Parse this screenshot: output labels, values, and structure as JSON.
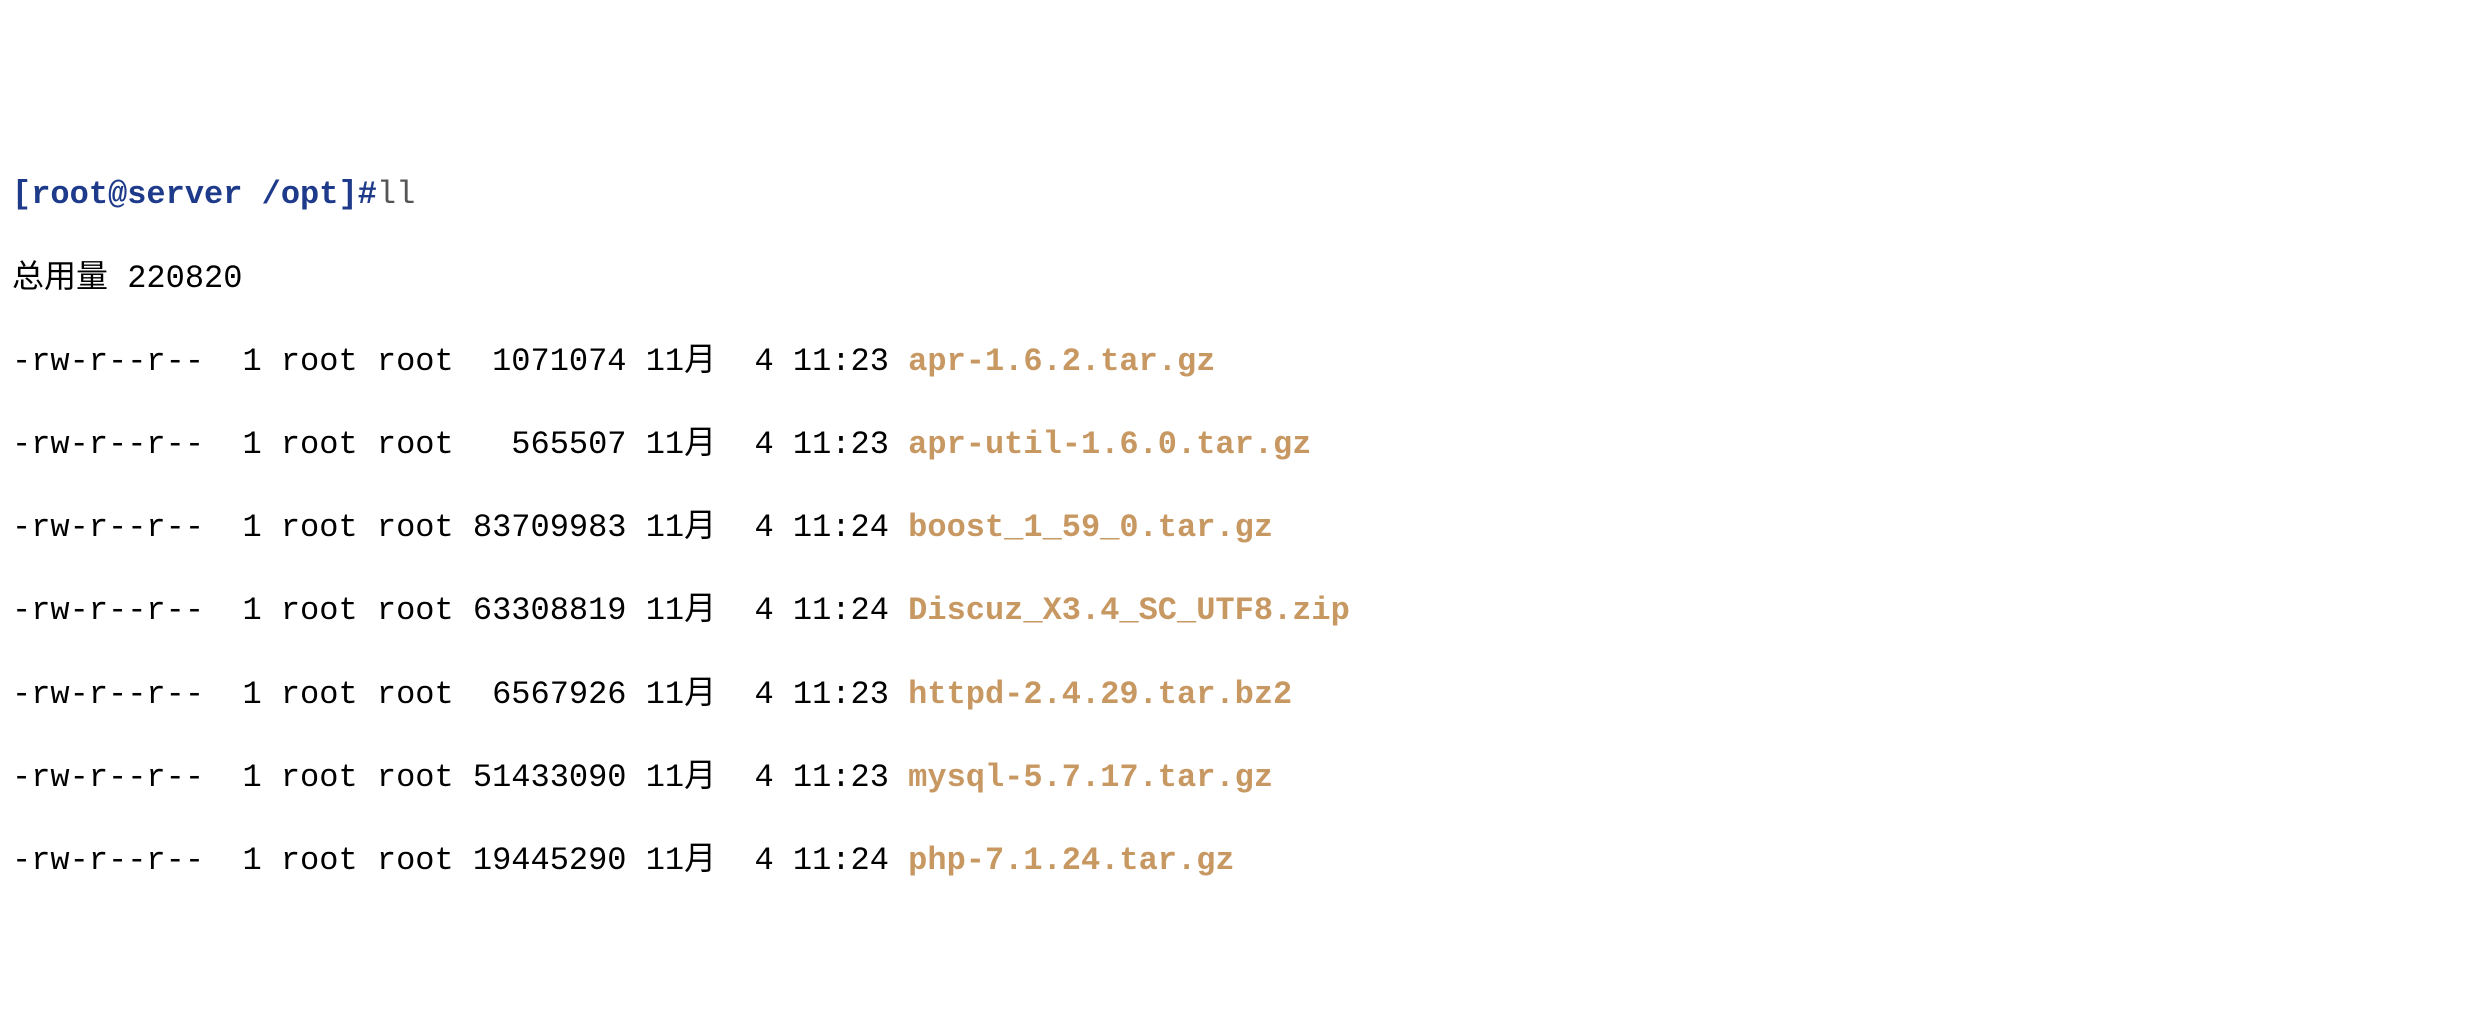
{
  "prompt": {
    "user_host": "[root@server",
    "path": " /opt]",
    "hash": "#",
    "command": "ll"
  },
  "total": {
    "label": "总用量 220820"
  },
  "files": [
    {
      "details": "-rw-r--r--  1 root root  1071074 11月  4 11:23 ",
      "name": "apr-1.6.2.tar.gz"
    },
    {
      "details": "-rw-r--r--  1 root root   565507 11月  4 11:23 ",
      "name": "apr-util-1.6.0.tar.gz"
    },
    {
      "details": "-rw-r--r--  1 root root 83709983 11月  4 11:24 ",
      "name": "boost_1_59_0.tar.gz"
    },
    {
      "details": "-rw-r--r--  1 root root 63308819 11月  4 11:24 ",
      "name": "Discuz_X3.4_SC_UTF8.zip"
    },
    {
      "details": "-rw-r--r--  1 root root  6567926 11月  4 11:23 ",
      "name": "httpd-2.4.29.tar.bz2"
    },
    {
      "details": "-rw-r--r--  1 root root 51433090 11月  4 11:23 ",
      "name": "mysql-5.7.17.tar.gz"
    },
    {
      "details": "-rw-r--r--  1 root root 19445290 11月  4 11:24 ",
      "name": "php-7.1.24.tar.gz"
    }
  ]
}
